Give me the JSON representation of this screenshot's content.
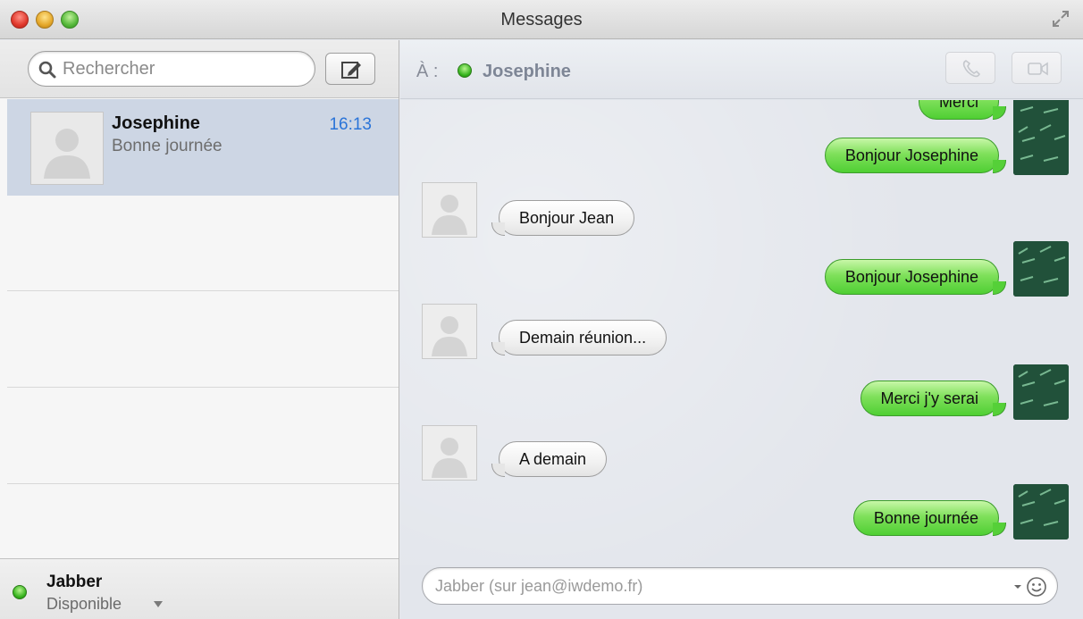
{
  "window": {
    "title": "Messages"
  },
  "sidebar": {
    "search_placeholder": "Rechercher",
    "conversations": [
      {
        "name": "Josephine",
        "time": "16:13",
        "preview": "Bonne journée"
      }
    ],
    "account": {
      "name": "Jabber",
      "status": "Disponible"
    }
  },
  "chat": {
    "to_label": "À :",
    "recipient": "Josephine",
    "messages": [
      {
        "direction": "out",
        "text": "Merci"
      },
      {
        "direction": "out",
        "text": "Bonjour Josephine"
      },
      {
        "direction": "in",
        "text": "Bonjour Jean"
      },
      {
        "direction": "out",
        "text": "Bonjour Josephine"
      },
      {
        "direction": "in",
        "text": "Demain réunion..."
      },
      {
        "direction": "out",
        "text": "Merci j'y serai"
      },
      {
        "direction": "in",
        "text": "A demain"
      },
      {
        "direction": "out",
        "text": "Bonne journée"
      }
    ],
    "composer_placeholder": "Jabber (sur jean@iwdemo.fr)"
  },
  "colors": {
    "accent_time": "#2a74d8",
    "online": "#34b21c",
    "outgoing_bubble": "#5fd43f",
    "selected_row": "#cdd6e4"
  },
  "icons": [
    "search-icon",
    "compose-icon",
    "phone-icon",
    "video-camera-icon",
    "fullscreen-icon",
    "emoji-icon",
    "person-placeholder-icon"
  ]
}
